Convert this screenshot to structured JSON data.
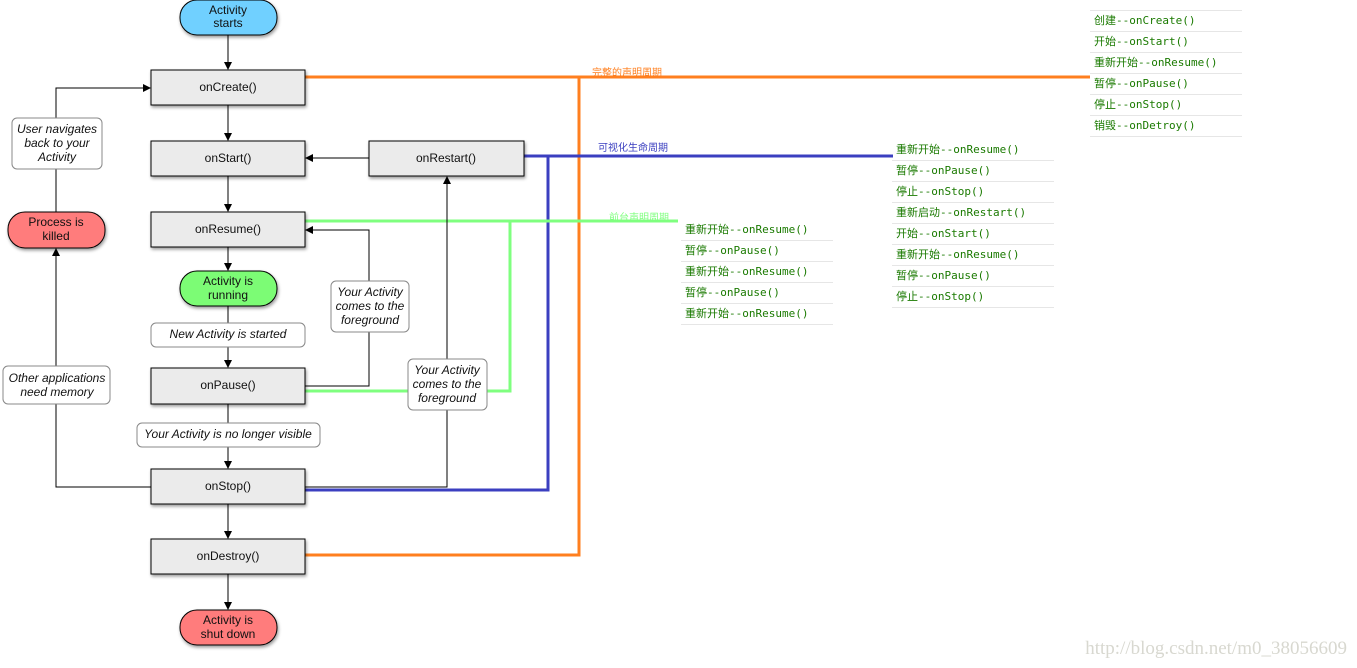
{
  "colors": {
    "full_lifetime": "#ff7f1f",
    "visible_lifetime": "#3b3fc0",
    "foreground_lifetime": "#7fff7f",
    "start": "#6fd0ff",
    "running": "#7cfc74",
    "end": "#ff7b7b",
    "list_text": "#1a7a00"
  },
  "nodes": {
    "start": [
      "Activity",
      "starts"
    ],
    "on_create": "onCreate()",
    "on_start": "onStart()",
    "on_restart": "onRestart()",
    "on_resume": "onResume()",
    "running": [
      "Activity is",
      "running"
    ],
    "on_pause": "onPause()",
    "on_stop": "onStop()",
    "on_destroy": "onDestroy()",
    "shut_down": [
      "Activity is",
      "shut down"
    ],
    "killed": [
      "Process is",
      "killed"
    ]
  },
  "notes": {
    "user_navigates": [
      "User navigates",
      "back to your",
      "Activity"
    ],
    "new_activity": "New Activity is started",
    "no_longer_visible": "Your Activity is no longer visible",
    "other_apps": [
      "Other applications",
      "need memory"
    ],
    "foreground1": [
      "Your Activity",
      "comes to the",
      "foreground"
    ],
    "foreground2": [
      "Your Activity",
      "comes to the",
      "foreground"
    ]
  },
  "lifetimes": {
    "full": "完整的声明周期",
    "visible": "可视化生命周期",
    "foreground": "前台声明周期"
  },
  "lists": {
    "full": [
      "创建--onCreate()",
      "开始--onStart()",
      "重新开始--onResume()",
      "暂停--onPause()",
      "停止--onStop()",
      "销毁--onDetroy()"
    ],
    "visible": [
      "重新开始--onResume()",
      "暂停--onPause()",
      "停止--onStop()",
      "重新启动--onRestart()",
      "开始--onStart()",
      "重新开始--onResume()",
      "暂停--onPause()",
      "停止--onStop()"
    ],
    "foreground": [
      "重新开始--onResume()",
      "暂停--onPause()",
      "重新开始--onResume()",
      "暂停--onPause()",
      "重新开始--onResume()"
    ]
  },
  "watermark": "http://blog.csdn.net/m0_38056609"
}
